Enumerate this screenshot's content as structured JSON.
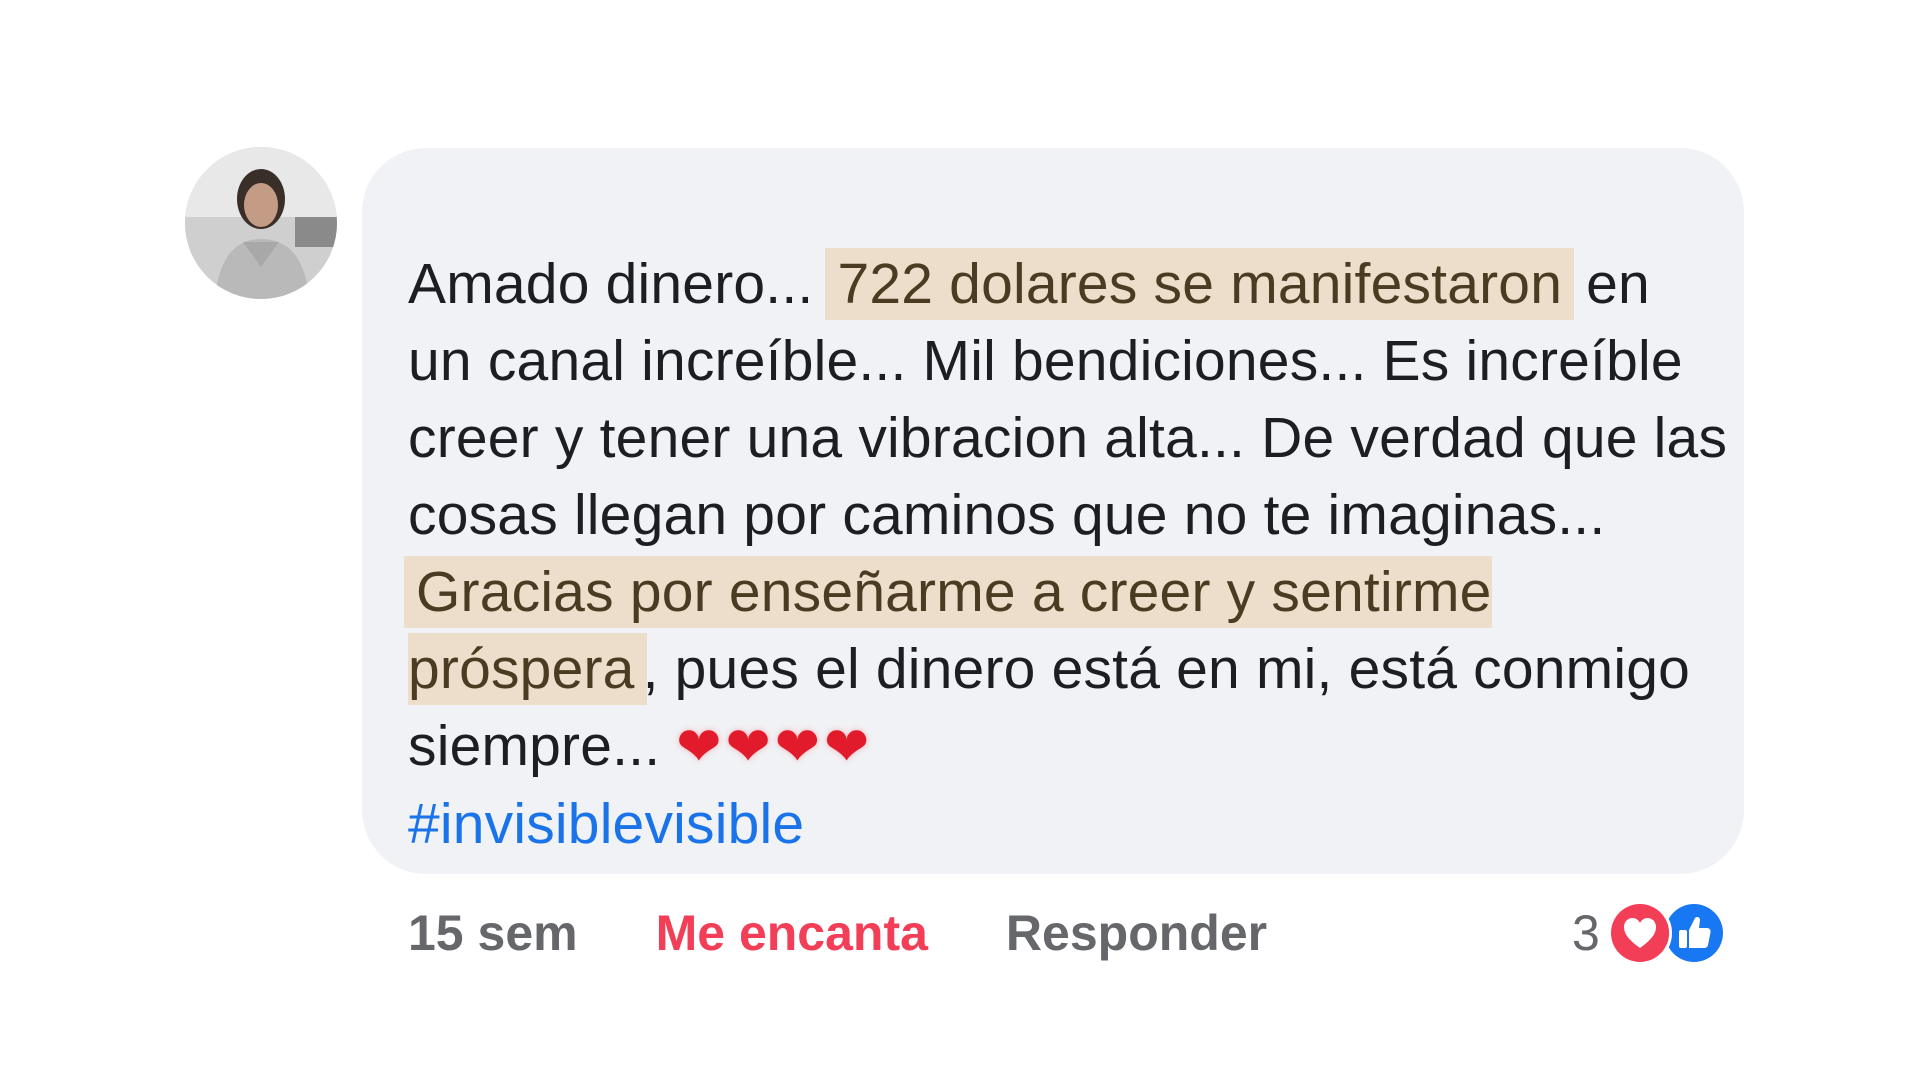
{
  "comment": {
    "text_intro": "Amado dinero... ",
    "highlight_1": "722 dolares se manifestaron",
    "text_mid": " en un canal increíble... Mil bendiciones... Es increíble creer y tener una vibracion alta... De verdad que las cosas llegan por caminos que no te imaginas... ",
    "highlight_2": "Gracias por enseñarme a creer y sentirme próspera",
    "text_end": ", pues el dinero está en mi, está conmigo siempre... ",
    "hearts": "❤❤❤❤",
    "hashtag": "#invisiblevisible"
  },
  "actions": {
    "time": "15 sem",
    "love_label": "Me encanta",
    "reply_label": "Responder"
  },
  "reactions": {
    "count": "3",
    "types": [
      "love-reaction-icon",
      "like-reaction-icon"
    ]
  },
  "colors": {
    "bubble": "#f0f2f5",
    "highlight": "#eddecb",
    "love": "#f33e58",
    "hashtag": "#1a73e8",
    "like": "#1877f2"
  }
}
